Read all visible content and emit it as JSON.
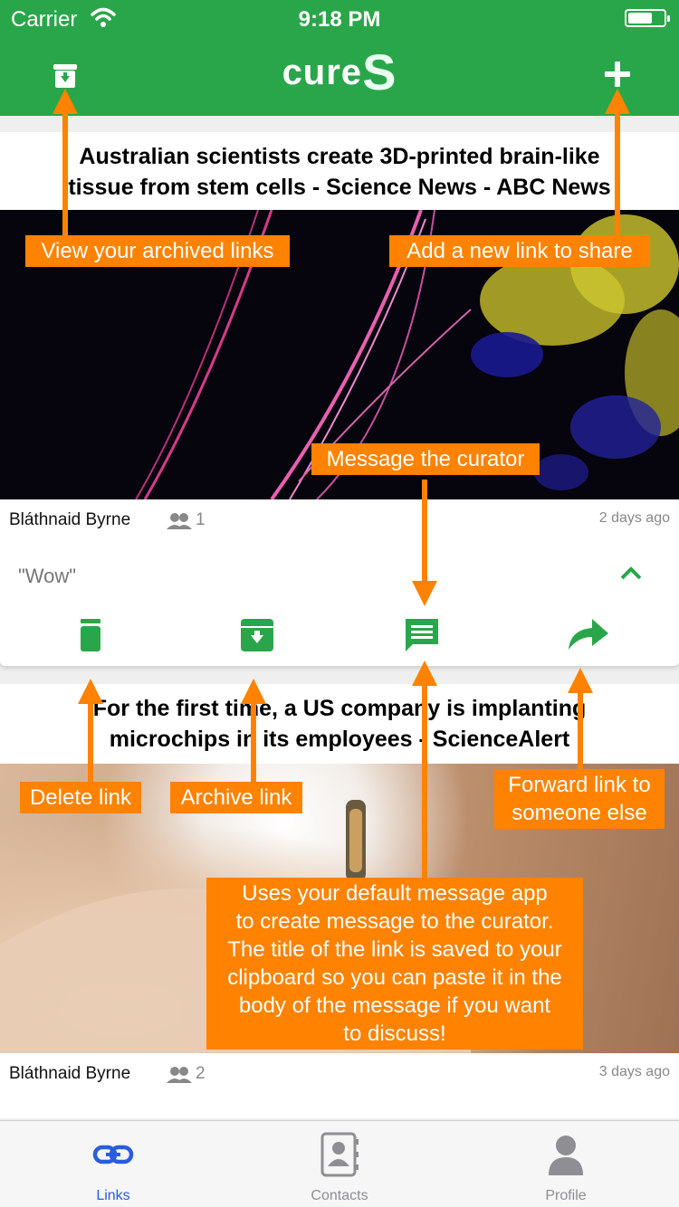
{
  "status_bar": {
    "carrier": "Carrier",
    "time": "9:18 PM"
  },
  "nav": {
    "logo_text": "cure",
    "logo_mark": "S",
    "left_icon": "archive-icon",
    "right_icon": "plus-icon"
  },
  "links": [
    {
      "title_line1": "Australian scientists create 3D-printed brain-like",
      "title_line2": "tissue from stem cells - Science News - ABC News",
      "curator": "Bláthnaid Byrne",
      "shared_count": "1",
      "time_ago": "2 days ago",
      "comment": "\"Wow\"",
      "actions": [
        "trash-icon",
        "archive-icon",
        "message-icon",
        "forward-icon"
      ]
    },
    {
      "title_line1": "For the first time, a US company is implanting",
      "title_line2": "microchips in its employees - ScienceAlert",
      "curator": "Bláthnaid Byrne",
      "shared_count": "2",
      "time_ago": "3 days ago"
    }
  ],
  "tabs": [
    {
      "label": "Links",
      "icon": "link-icon",
      "active": true
    },
    {
      "label": "Contacts",
      "icon": "contacts-icon",
      "active": false
    },
    {
      "label": "Profile",
      "icon": "profile-icon",
      "active": false
    }
  ],
  "annotations": {
    "archived": "View your archived links",
    "add": "Add a new link to share",
    "message": "Message the curator",
    "delete": "Delete link",
    "archive": "Archive link",
    "forward_line1": "Forward link to",
    "forward_line2": "someone else",
    "uses_line1": "Uses your default message app",
    "uses_line2": "to create message to the curator.",
    "uses_line3": "The title of the link is saved to your",
    "uses_line4": "clipboard so you can paste it in the",
    "uses_line5": "body of the message if you want",
    "uses_line6": "to discuss!"
  },
  "colors": {
    "brand_green": "#2aa64a",
    "annotation_orange": "#ff8200",
    "active_tab": "#2b5ce0"
  }
}
